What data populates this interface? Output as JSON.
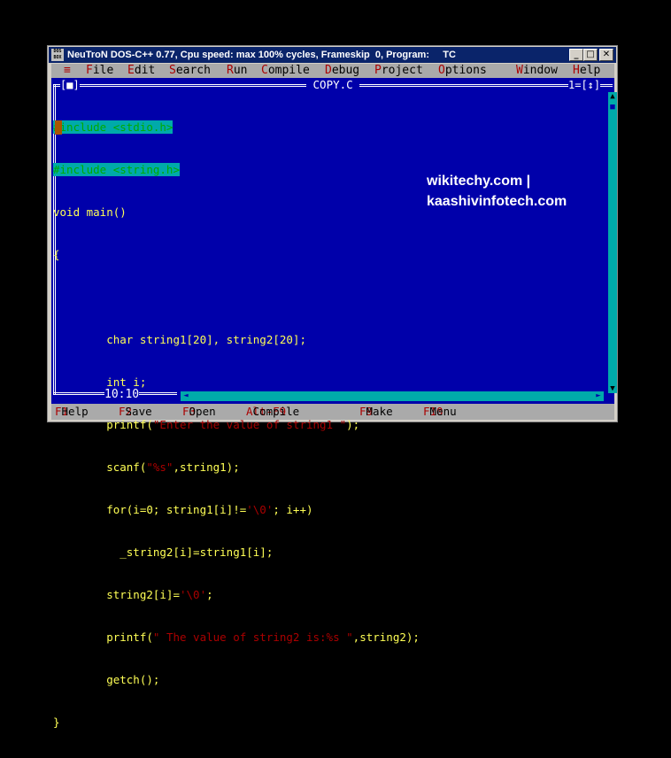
{
  "window": {
    "title": "NeuTroN DOS-C++ 0.77, Cpu speed: max 100% cycles, Frameskip  0, Program:     TC",
    "icon_text": "DOS BOX",
    "minimize": "_",
    "maximize": "□",
    "close": "✕"
  },
  "menubar": {
    "system": "≡",
    "items": [
      {
        "hotkey": "F",
        "rest": "ile"
      },
      {
        "hotkey": "E",
        "rest": "dit"
      },
      {
        "hotkey": "S",
        "rest": "earch"
      },
      {
        "hotkey": "R",
        "rest": "un"
      },
      {
        "hotkey": "C",
        "rest": "ompile"
      },
      {
        "hotkey": "D",
        "rest": "ebug"
      },
      {
        "hotkey": "P",
        "rest": "roject"
      },
      {
        "hotkey": "O",
        "rest": "ptions"
      },
      {
        "hotkey": "W",
        "rest": "indow"
      },
      {
        "hotkey": "H",
        "rest": "elp"
      }
    ]
  },
  "editor": {
    "close_box": "[■]",
    "filename": " COPY.C ",
    "window_number": "1=[↕]",
    "position": "10:10",
    "lines": [
      "#include <stdio.h>",
      "#include <string.h>",
      "void main()",
      "{",
      "",
      "        char string1[20], string2[20];",
      "        int i;",
      "        printf(\"Enter the value of string1 \");",
      "        scanf(\"%s\",string1);",
      "        for(i=0; string1[i]!='\\0'; i++)",
      "          _string2[i]=string1[i];",
      "        string2[i]='\\0';",
      "        printf(\" The value of string2 is:%s \",string2);",
      "        getch();",
      "}"
    ]
  },
  "watermark": {
    "line1": "wikitechy.com |",
    "line2": "kaashivinfotech.com"
  },
  "function_keys": [
    {
      "key": "F1",
      "label": "Help"
    },
    {
      "key": "F2",
      "label": "Save"
    },
    {
      "key": "F3",
      "label": "Open"
    },
    {
      "key": "Alt-F9",
      "label": "Compile"
    },
    {
      "key": "F9",
      "label": "Make"
    },
    {
      "key": "F10",
      "label": "Menu"
    }
  ],
  "colors": {
    "dos_blue": "#0000aa",
    "dos_cyan": "#00aaaa",
    "dos_yellow": "#ffff55",
    "dos_red": "#aa0000",
    "dos_gray": "#aaaaaa",
    "titlebar_blue": "#0a246a"
  }
}
